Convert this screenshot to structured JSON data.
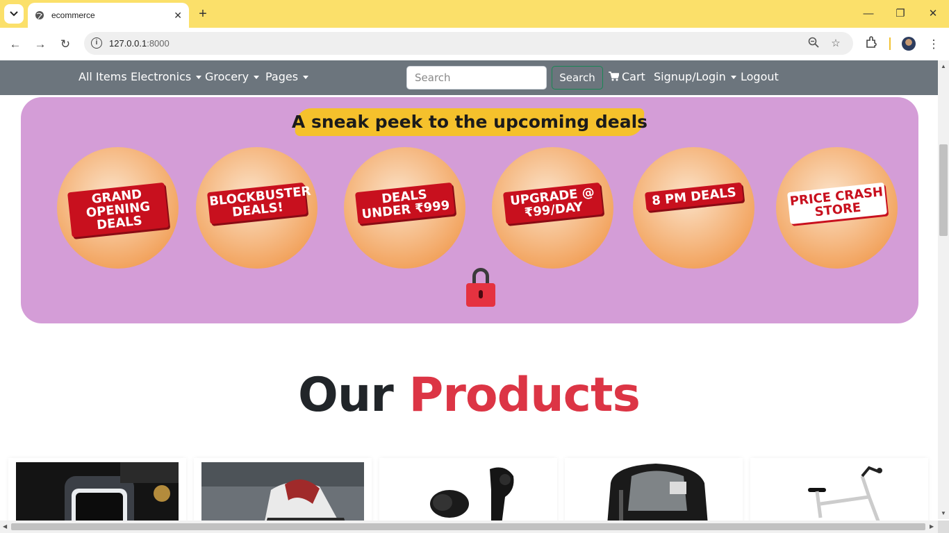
{
  "browser": {
    "tab_title": "ecommerce",
    "url_host": "127.0.0.1",
    "url_port": ":8000"
  },
  "nav": {
    "items": [
      {
        "label": "All Items",
        "dropdown": false
      },
      {
        "label": "Electronics",
        "dropdown": true
      },
      {
        "label": "Grocery",
        "dropdown": true
      },
      {
        "label": "Pages",
        "dropdown": true
      }
    ],
    "search_placeholder": "Search",
    "search_button": "Search",
    "cart_label": "Cart",
    "signup_label": "Signup/Login",
    "logout_label": "Logout"
  },
  "banner": {
    "title": "A sneak peek to the upcoming deals",
    "deals": [
      "GRAND OPENING DEALS",
      "BLOCKBUSTER DEALS!",
      "DEALS UNDER ₹999",
      "UPGRADE @ ₹99/DAY",
      "8 PM DEALS",
      "PRICE CRASH STORE"
    ]
  },
  "heading": {
    "part1": "Our",
    "part2": "Products"
  },
  "colors": {
    "navbar": "#6c757d",
    "accent": "#dc3545",
    "banner_bg": "#d49dd7",
    "tabbar": "#fbe06a"
  },
  "products": [
    "smartwatch",
    "sneaker",
    "earbuds",
    "backpack",
    "bicycle"
  ]
}
